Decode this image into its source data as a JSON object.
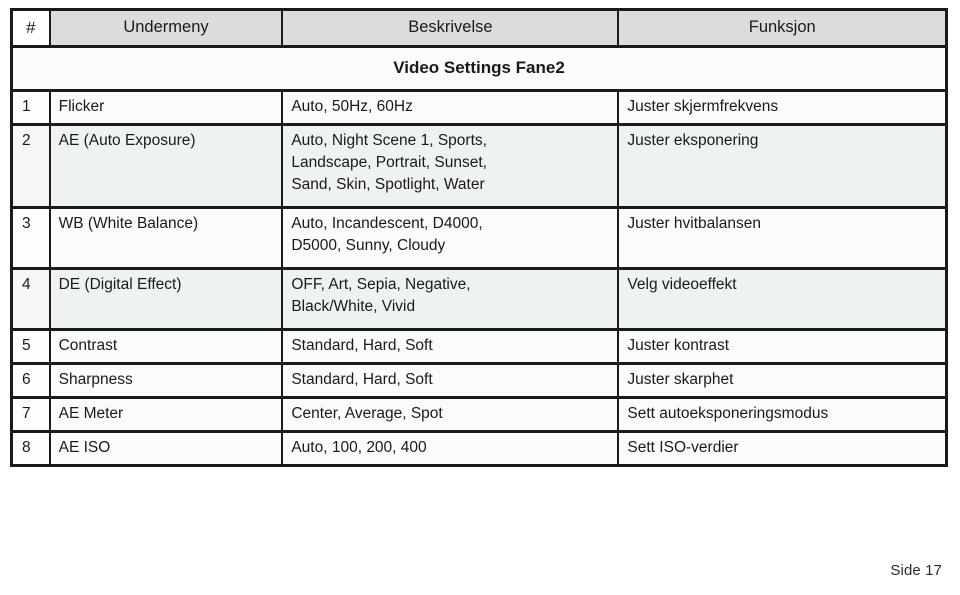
{
  "table": {
    "columns": [
      {
        "key": "num",
        "label": "#"
      },
      {
        "key": "menu",
        "label": "Undermeny"
      },
      {
        "key": "desc",
        "label": "Beskrivelse"
      },
      {
        "key": "func",
        "label": "Funksjon"
      }
    ],
    "section_title": "Video Settings Fane2",
    "rows": [
      {
        "num": "1",
        "menu": "Flicker",
        "desc": "Auto, 50Hz, 60Hz",
        "func": "Juster skjermfrekvens"
      },
      {
        "num": "2",
        "menu": "AE (Auto Exposure)",
        "desc": "Auto, Night Scene 1, Sports,\nLandscape, Portrait, Sunset,\nSand, Skin, Spotlight, Water",
        "func": "Juster eksponering"
      },
      {
        "num": "3",
        "menu": "WB (White Balance)",
        "desc": "Auto, Incandescent, D4000,\nD5000, Sunny, Cloudy",
        "func": "Juster hvitbalansen"
      },
      {
        "num": "4",
        "menu": "DE (Digital Effect)",
        "desc": "OFF, Art, Sepia, Negative,\nBlack/White, Vivid",
        "func": "Velg videoeffekt"
      },
      {
        "num": "5",
        "menu": "Contrast",
        "desc": "Standard, Hard, Soft",
        "func": "Juster kontrast"
      },
      {
        "num": "6",
        "menu": "Sharpness",
        "desc": "Standard, Hard, Soft",
        "func": "Juster skarphet"
      },
      {
        "num": "7",
        "menu": "AE Meter",
        "desc": "Center, Average, Spot",
        "func": "Sett autoeksponeringsmodus"
      },
      {
        "num": "8",
        "menu": "AE ISO",
        "desc": "Auto, 100, 200, 400",
        "func": "Sett ISO-verdier"
      }
    ]
  },
  "footer": {
    "page_label": "Side 17"
  }
}
